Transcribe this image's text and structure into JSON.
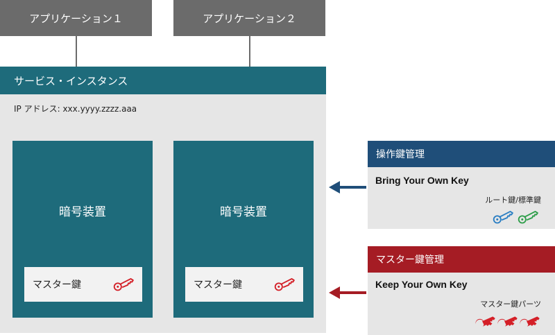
{
  "apps": [
    {
      "label": "アプリケーション１"
    },
    {
      "label": "アプリケーション２"
    }
  ],
  "instance": {
    "title": "サービス・インスタンス",
    "ip": "IP アドレス: xxx.yyyy.zzzz.aaa",
    "hsms": [
      {
        "title": "暗号装置",
        "master_key": "マスター鍵"
      },
      {
        "title": "暗号装置",
        "master_key": "マスター鍵"
      }
    ]
  },
  "byok": {
    "header": "操作鍵管理",
    "title": "Bring Your Own Key",
    "sub": "ルート鍵/標準鍵",
    "color": "#1f4e79"
  },
  "kyok": {
    "header": "マスター鍵管理",
    "title": "Keep Your Own Key",
    "sub": "マスター鍵パーツ",
    "color": "#a51c24"
  },
  "colors": {
    "app_box": "#6b6b6b",
    "teal": "#1e6b7b",
    "panel_bg": "#e6e6e6",
    "key_red": "#d42028",
    "key_blue": "#2a7ec3",
    "key_green": "#2e9e4a"
  }
}
